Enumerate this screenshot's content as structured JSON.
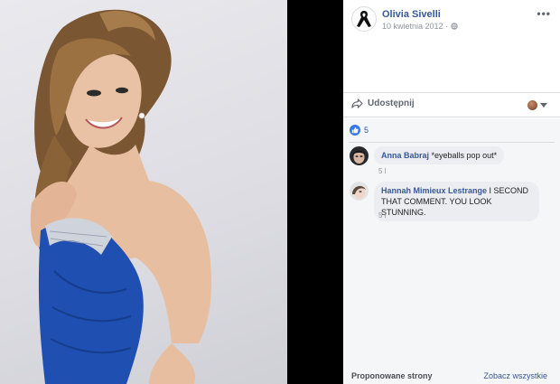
{
  "post": {
    "author": "Olivia Sivelli",
    "date": "10 kwietnia 2012 ·",
    "avatar_icon": "black-ribbon-icon",
    "privacy_icon": "globe-icon",
    "more_label": "•••"
  },
  "actions": {
    "share_label": "Udostępnij",
    "share_icon": "share-arrow-icon"
  },
  "reactions": {
    "like_count": "5",
    "like_icon": "thumbs-up-icon"
  },
  "comments": [
    {
      "name": "Anna Babraj",
      "text": "*eyeballs pop out*",
      "meta": "5 l"
    },
    {
      "name": "Hannah Mimieux Lestrange",
      "text": "I SECOND THAT COMMENT. YOU LOOK STUNNING.",
      "meta": "5 l"
    }
  ],
  "suggestions": {
    "title": "Proponowane strony",
    "see_all": "Zobacz wszystkie"
  },
  "colors": {
    "link": "#385898",
    "like": "#3578e5",
    "dress": "#1f4fb0"
  }
}
